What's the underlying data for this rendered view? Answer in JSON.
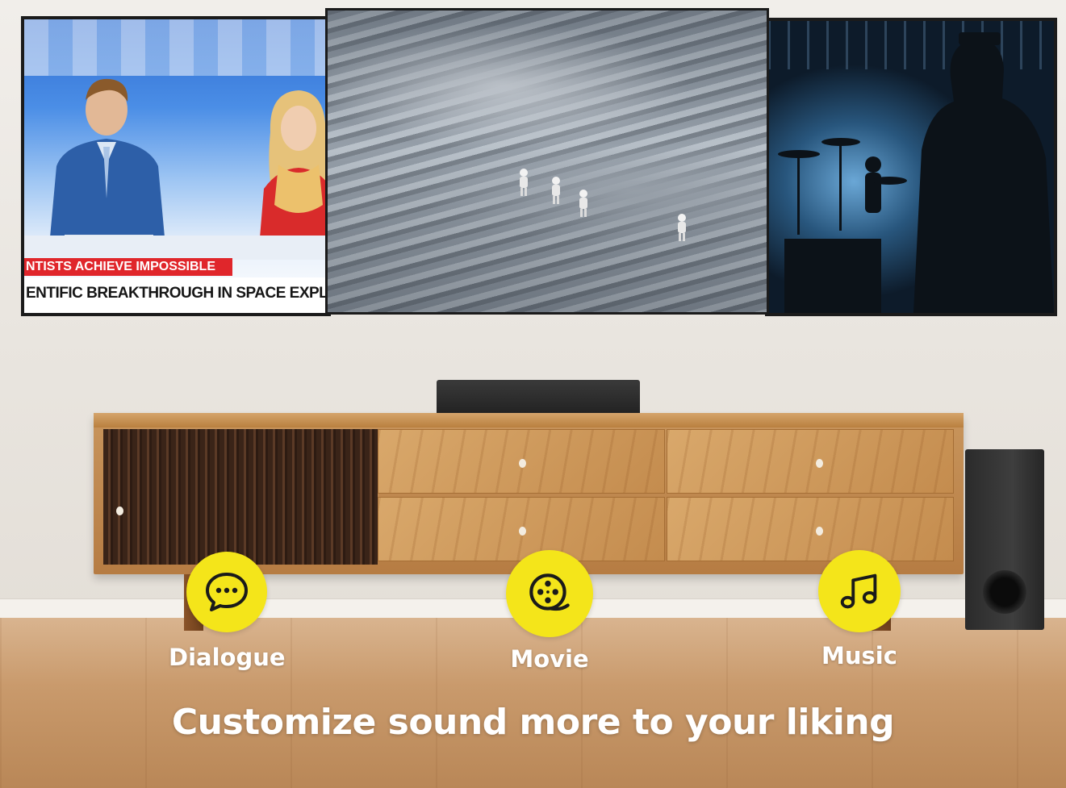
{
  "screens": {
    "news": {
      "headline_top": "NTISTS ACHIEVE IMPOSSIBLE",
      "headline_bottom": "ENTIFIC BREAKTHROUGH IN SPACE EXPLORING"
    }
  },
  "modes": [
    {
      "label": "Dialogue",
      "icon": "chat-bubble-icon"
    },
    {
      "label": "Movie",
      "icon": "film-reel-icon"
    },
    {
      "label": "Music",
      "icon": "music-note-icon"
    }
  ],
  "tagline": "Customize sound more to your liking",
  "colors": {
    "accent_yellow": "#f4e51a",
    "label_text": "#ffffff",
    "news_red": "#e0262b"
  }
}
